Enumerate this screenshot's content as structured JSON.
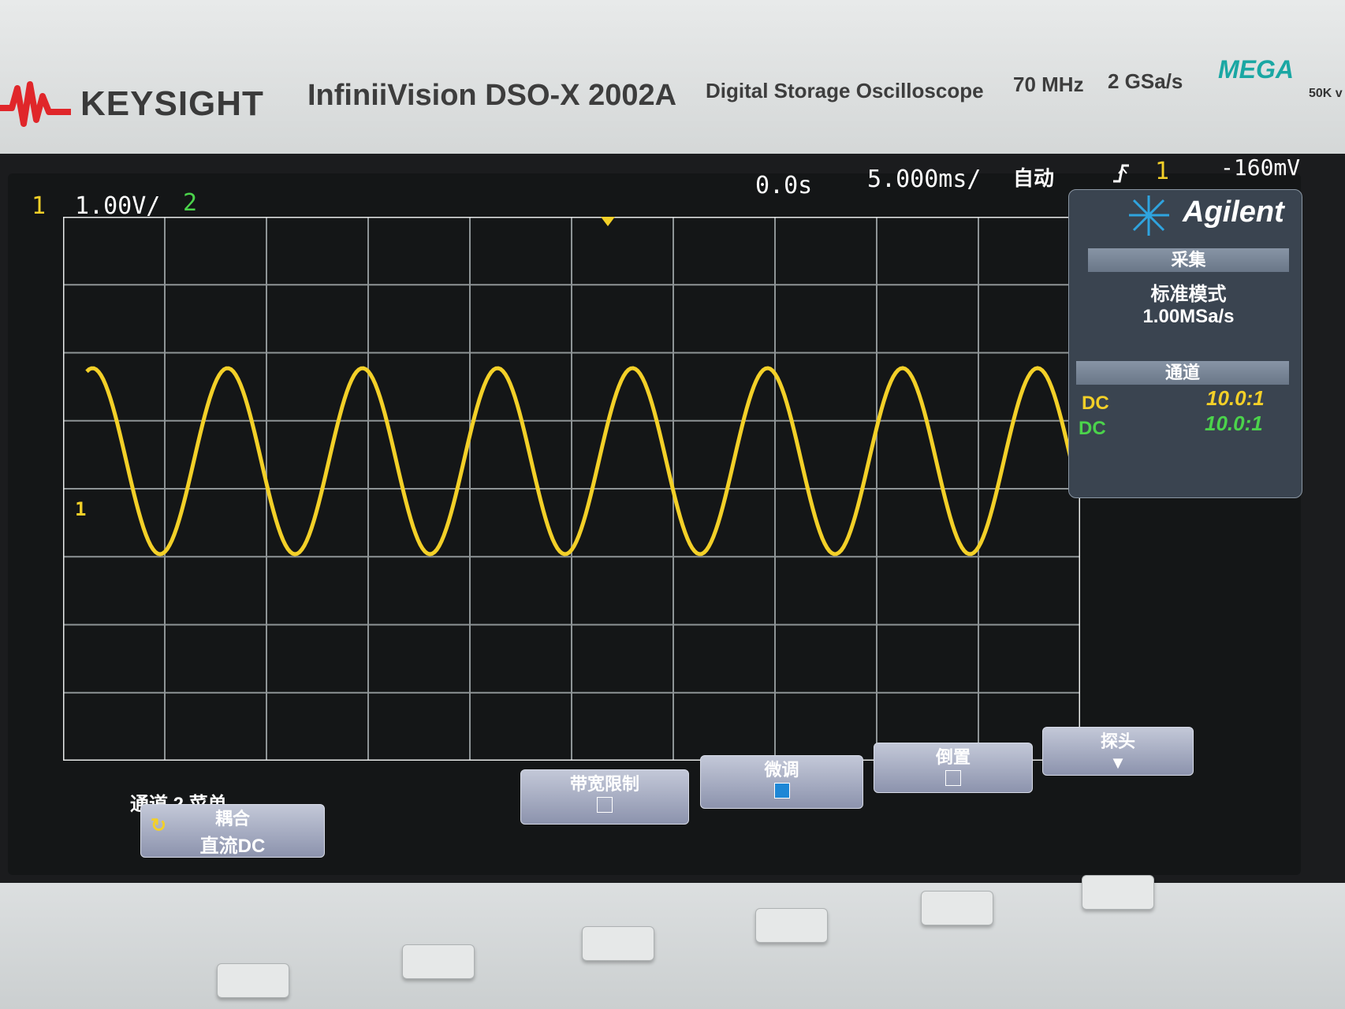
{
  "instrument": {
    "brand": "KEYSIGHT",
    "model": "InfiniiVision DSO-X 2002A",
    "description": "Digital Storage Oscilloscope",
    "bandwidth": "70 MHz",
    "sample_rate": "2 GSa/s",
    "badge": "MEGA",
    "badge_sub": "50K v",
    "display_logo": "Agilent"
  },
  "status_bar": {
    "ch1_number": "1",
    "ch1_scale": "1.00V/",
    "ch2_number": "2",
    "time_delay": "0.0s",
    "time_scale": "5.000ms/",
    "trigger_mode": "自动",
    "trigger_icon": "rising-edge-icon",
    "trigger_source": "1",
    "trigger_level": "-160mV"
  },
  "channel_marker": "1",
  "side_panel": {
    "acquire_header": "采集",
    "acquire_mode": "标准模式",
    "acquire_rate": "1.00MSa/s",
    "channels_header": "通道",
    "channels": [
      {
        "coupling": "DC",
        "probe": "10.0:1",
        "color": "#f3d028"
      },
      {
        "coupling": "DC",
        "probe": "10.0:1",
        "color": "#4bd34b"
      }
    ]
  },
  "menu": {
    "title": "通道 2 菜单",
    "buttons": [
      {
        "label": "耦合",
        "value": "直流DC"
      },
      {
        "label": "带宽限制",
        "checked": false
      },
      {
        "label": "微调",
        "checked": true
      },
      {
        "label": "倒置",
        "checked": false
      },
      {
        "label": "探头"
      }
    ]
  },
  "colors": {
    "ch1": "#f3d028",
    "ch2": "#4bd34b",
    "grid": "#8e9496",
    "screen": "#141617"
  }
}
